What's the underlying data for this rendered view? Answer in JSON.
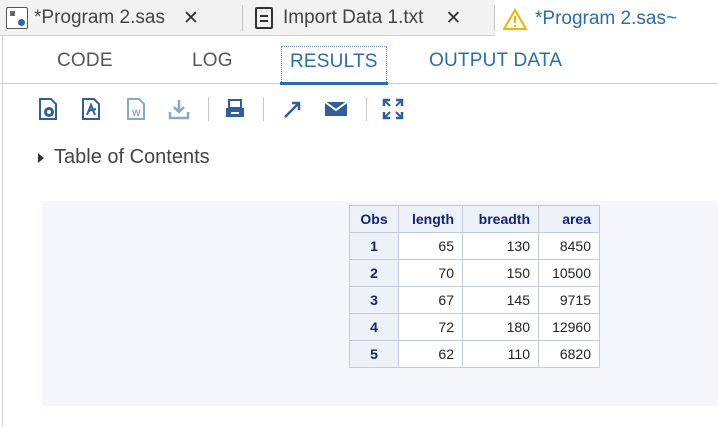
{
  "file_tabs": [
    {
      "name": "*Program 2.sas",
      "close": "✕",
      "icon": "program-icon"
    },
    {
      "name": "Import Data 1.txt",
      "close": "✕",
      "icon": "document-icon"
    },
    {
      "name": "*Program 2.sas~",
      "icon": "warning-icon"
    }
  ],
  "view_tabs": [
    "CODE",
    "LOG",
    "RESULTS",
    "OUTPUT DATA"
  ],
  "active_view_tab": "RESULTS",
  "toolbar": [
    "html-download-icon",
    "pdf-download-icon",
    "word-download-icon",
    "download-icon",
    "print-icon",
    "open-new-window-icon",
    "email-icon",
    "maximize-icon"
  ],
  "toc_label": "Table of Contents",
  "table": {
    "columns": [
      "Obs",
      "length",
      "breadth",
      "area"
    ],
    "rows": [
      [
        "1",
        "65",
        "130",
        "8450"
      ],
      [
        "2",
        "70",
        "150",
        "10500"
      ],
      [
        "3",
        "67",
        "145",
        "9715"
      ],
      [
        "4",
        "72",
        "180",
        "12960"
      ],
      [
        "5",
        "62",
        "110",
        "6820"
      ]
    ]
  },
  "colors": {
    "accent": "#2a6cb0",
    "header_text": "#112277",
    "warning": "#f0b400"
  }
}
